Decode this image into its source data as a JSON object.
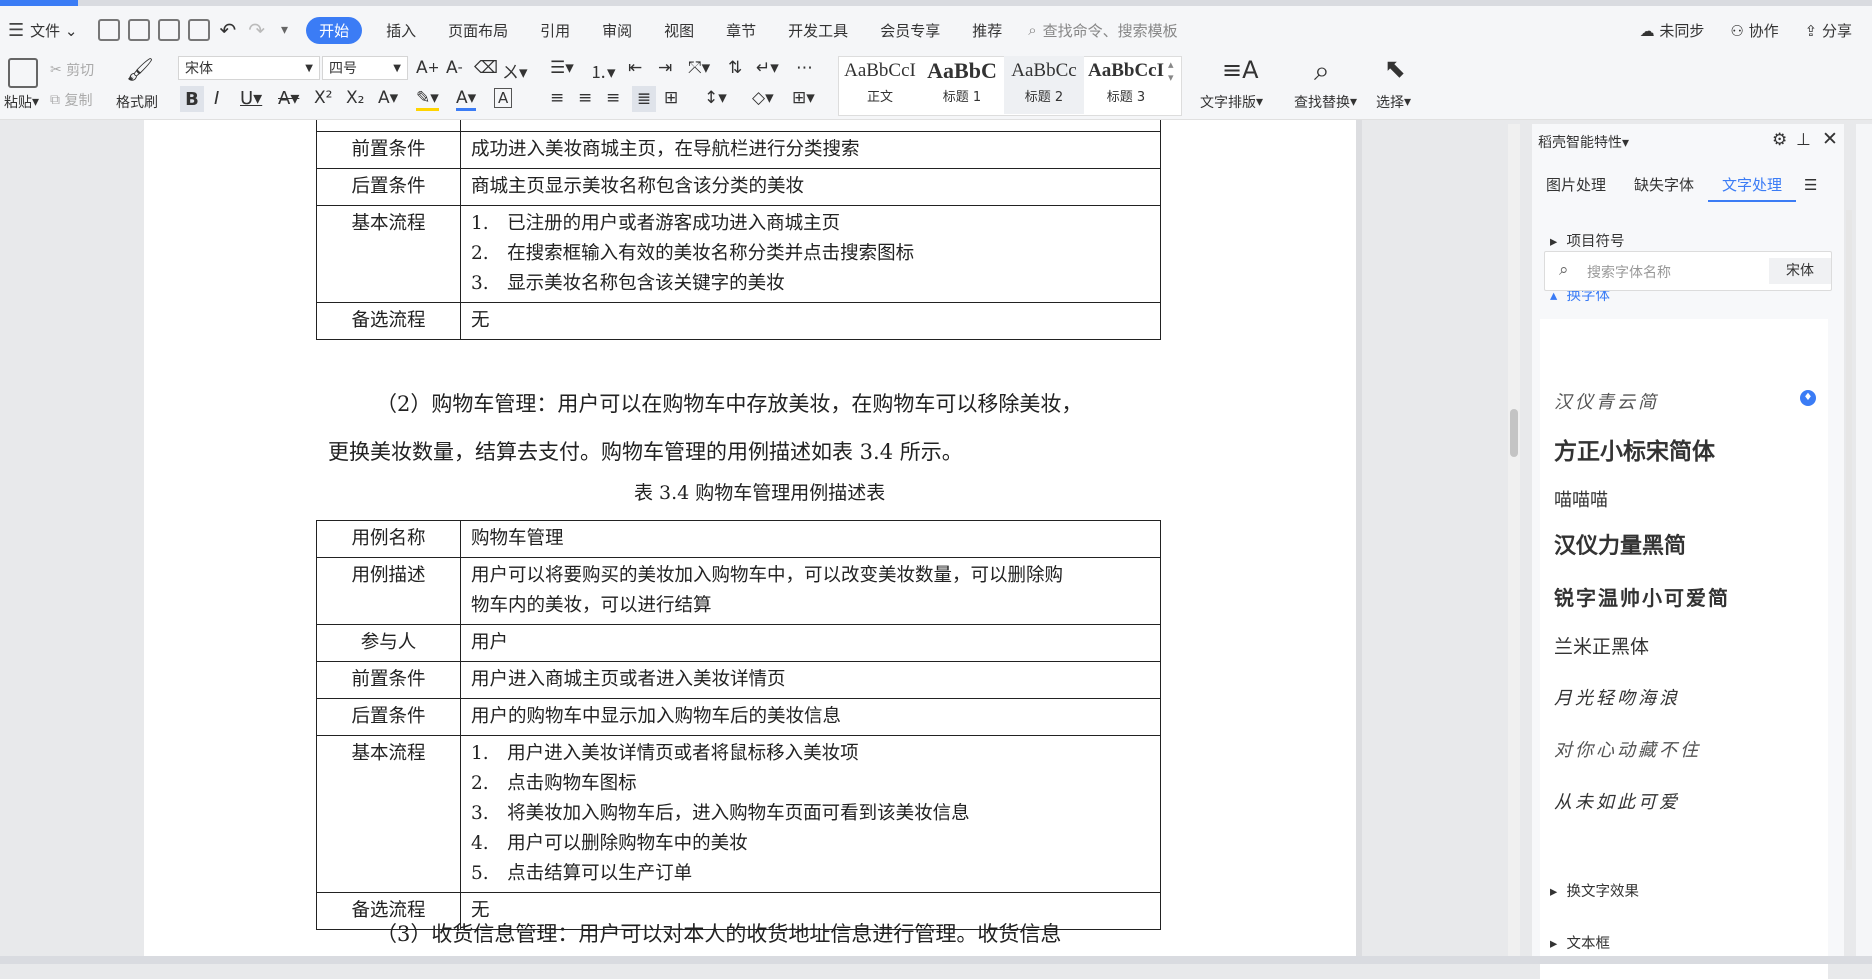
{
  "menu": {
    "file": "文件",
    "tabs": [
      "开始",
      "插入",
      "页面布局",
      "引用",
      "审阅",
      "视图",
      "章节",
      "开发工具",
      "会员专享",
      "推荐"
    ],
    "active_tab": "开始",
    "search_placeholder": "查找命令、搜索模板",
    "sync": "未同步",
    "collab": "协作",
    "share": "分享"
  },
  "ribbon": {
    "paste": "粘贴",
    "cut": "剪切",
    "copy": "复制",
    "format_painter": "格式刷",
    "font_name": "宋体",
    "font_size": "四号",
    "styles": [
      {
        "preview": "AaBbCcI",
        "label": "正文"
      },
      {
        "preview": "AaBbC",
        "label": "标题 1"
      },
      {
        "preview": "AaBbCc",
        "label": "标题 2"
      },
      {
        "preview": "AaBbCcI",
        "label": "标题 3"
      }
    ],
    "text_layout": "文字排版",
    "find_replace": "查找替换",
    "select": "选择"
  },
  "doc": {
    "table1": [
      {
        "k": "前置条件",
        "v": [
          "成功进入美妆商城主页，在导航栏进行分类搜索"
        ]
      },
      {
        "k": "后置条件",
        "v": [
          "商城主页显示美妆名称包含该分类的美妆"
        ]
      },
      {
        "k": "基本流程",
        "v": [
          "1. 已注册的用户或者游客成功进入商城主页",
          "2. 在搜索框输入有效的美妆名称分类并点击搜索图标",
          "3. 显示美妆名称包含该关键字的美妆"
        ]
      },
      {
        "k": "备选流程",
        "v": [
          "无"
        ]
      }
    ],
    "para1_line1": "（2）购物车管理：用户可以在购物车中存放美妆，在购物车可以移除美妆，",
    "para1_line2": "更换美妆数量，结算去支付。购物车管理的用例描述如表 3.4 所示。",
    "caption": "表 3.4  购物车管理用例描述表",
    "table2": [
      {
        "k": "用例名称",
        "v": [
          "购物车管理"
        ]
      },
      {
        "k": "用例描述",
        "v": [
          "用户可以将要购买的美妆加入购物车中，可以改变美妆数量，可以删除购",
          "物车内的美妆，可以进行结算"
        ]
      },
      {
        "k": "参与人",
        "v": [
          "用户"
        ]
      },
      {
        "k": "前置条件",
        "v": [
          "用户进入商城主页或者进入美妆详情页"
        ]
      },
      {
        "k": "后置条件",
        "v": [
          "用户的购物车中显示加入购物车后的美妆信息"
        ]
      },
      {
        "k": "基本流程",
        "v": [
          "1. 用户进入美妆详情页或者将鼠标移入美妆项",
          "2. 点击购物车图标",
          "3. 将美妆加入购物车后，进入购物车页面可看到该美妆信息",
          "4. 用户可以删除购物车中的美妆",
          "5. 点击结算可以生产订单"
        ]
      },
      {
        "k": "备选流程",
        "v": [
          "无"
        ]
      }
    ],
    "para2_line1": "（3）收货信息管理：用户可以对本人的收货地址信息进行管理。收货信息"
  },
  "panel": {
    "title": "稻壳智能特性",
    "tabs": [
      "图片处理",
      "缺失字体",
      "文字处理"
    ],
    "active_tab": "文字处理",
    "sections": {
      "bullets": "项目符号",
      "change_font": "换字体",
      "text_effect": "换文字效果",
      "textbox": "文本框"
    },
    "font_search_placeholder": "搜索字体名称",
    "current_font": "宋体",
    "fonts": [
      "汉仪青云简",
      "方正小标宋简体",
      "喵喵喵",
      "汉仪力量黑简",
      "锐字温帅小可爱简",
      "兰米正黑体",
      "月光轻吻海浪",
      "对你心动藏不住",
      "从未如此可爱"
    ]
  }
}
